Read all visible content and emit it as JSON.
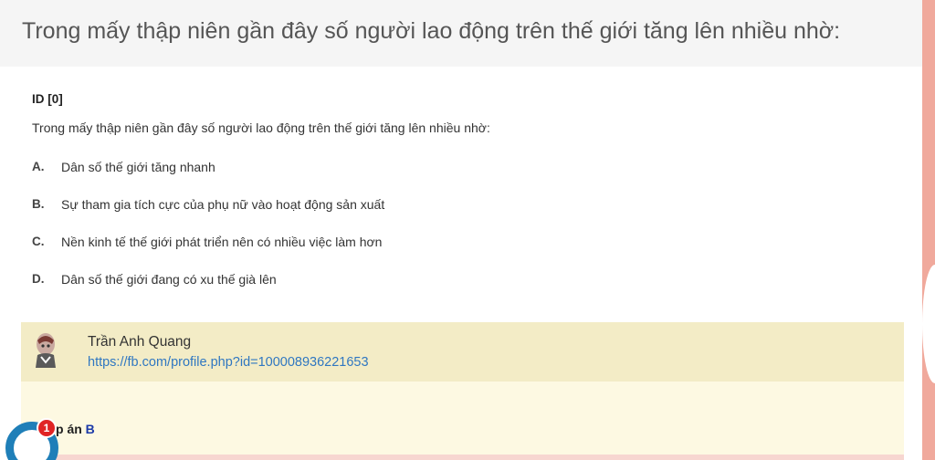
{
  "header": {
    "title": "Trong mấy thập niên gần đây số người lao động trên thế giới tăng lên nhiều nhờ:"
  },
  "question": {
    "id_label": "ID [0]",
    "text": "Trong mấy thập niên gần đây số người lao động trên thế giới tăng lên nhiều nhờ:",
    "options": [
      {
        "letter": "A.",
        "text": "Dân số thế giới tăng nhanh"
      },
      {
        "letter": "B.",
        "text": "Sự tham gia tích cực của phụ nữ vào hoạt động sản xuất"
      },
      {
        "letter": "C.",
        "text": "Nền kinh tế thế giới phát triển nên có nhiều việc làm hơn"
      },
      {
        "letter": "D.",
        "text": "Dân số thế giới đang có xu thế già lên"
      }
    ]
  },
  "author": {
    "name": "Trần Anh Quang",
    "link": "https://fb.com/profile.php?id=100008936221653"
  },
  "answer": {
    "label": "p án",
    "value": "B"
  },
  "chat": {
    "badge_count": "1"
  },
  "colors": {
    "header_bg": "#f5f5f5",
    "author_bg": "#f3ecc6",
    "answer_bg": "#fdf9e2",
    "link": "#2f77c1",
    "answer_accent": "#1b3aa8",
    "chat_blue": "#1f7fb8",
    "badge_red": "#e02424"
  }
}
